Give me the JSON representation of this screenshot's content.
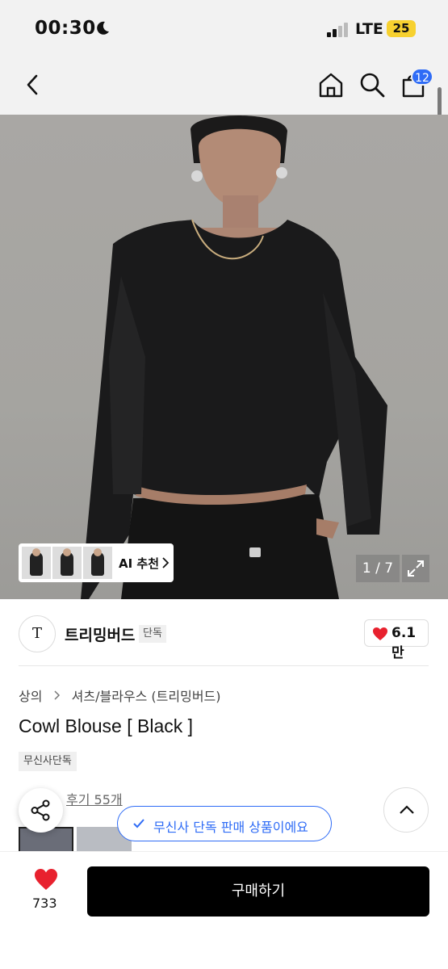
{
  "status_bar": {
    "time": "00:30",
    "network": "LTE",
    "battery": "25"
  },
  "nav": {
    "cart_count": "12"
  },
  "hero": {
    "page_counter": "1 / 7",
    "ai_recommend_label": "AI 추천"
  },
  "brand": {
    "logo_text": "T",
    "name": "트리밍버드",
    "tag": "단독",
    "like_count": "6.1만",
    "heart_color": "#e8212e"
  },
  "product": {
    "breadcrumb": [
      "상의",
      "셔츠/블라우스 (트리밍버드)"
    ],
    "title": "Cowl Blouse [ Black ]",
    "badge": "무신사단독",
    "review_link": "후기 55개"
  },
  "floating": {
    "exclusive_notice": "무신사 단독 판매 상품이에요",
    "accent_color": "#2f6cf6"
  },
  "bottom_bar": {
    "wish_count": "733",
    "buy_label": "구매하기"
  }
}
